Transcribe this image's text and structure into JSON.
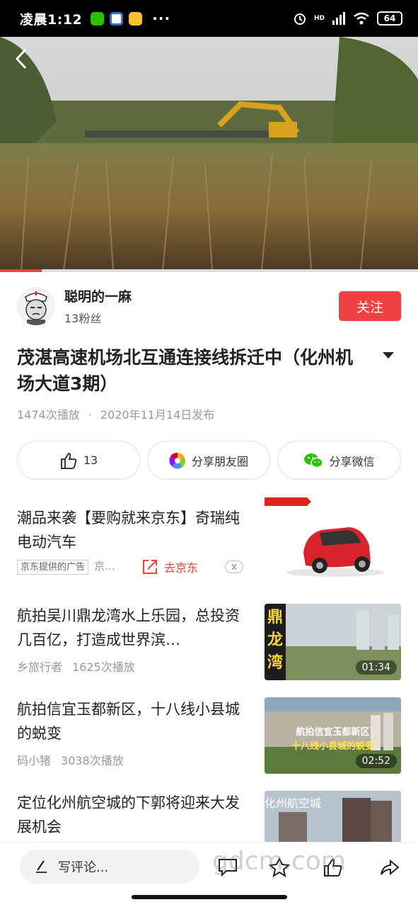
{
  "status_bar": {
    "time": "凌晨1:12",
    "more": "···",
    "network": "HD",
    "battery": "64",
    "icons": [
      "wechat-icon",
      "messenger-app-icon",
      "notes-app-icon",
      "alarm-icon",
      "signal-icon",
      "wifi-icon",
      "battery-icon"
    ]
  },
  "video": {
    "progress": 0.1,
    "icons": [
      "back-icon"
    ]
  },
  "author": {
    "name": "聪明的一麻",
    "fans": "13粉丝",
    "follow_label": "关注"
  },
  "article": {
    "title": "茂湛高速机场北互通连接线拆迁中（化州机场大道3期）",
    "views": "1474次播放",
    "separator": "·",
    "date": "2020年11月14日发布"
  },
  "actions": {
    "like_count": "13",
    "moments_label": "分享朋友圈",
    "wechat_label": "分享微信"
  },
  "ad": {
    "title": "潮品来袭【要购就来京东】奇瑞纯电动汽车",
    "tag": "京东提供的广告",
    "source": "京…",
    "cta": "去京东"
  },
  "related": [
    {
      "title": "航拍吴川鼎龙湾水上乐园，总投资几百亿，打造成世界滨…",
      "author": "乡旅行者",
      "plays": "1625次播放",
      "duration": "01:34",
      "thumb_text": "鼎龙湾"
    },
    {
      "title": "航拍信宜玉都新区，十八线小县城的蜕变",
      "author": "码小猪",
      "plays": "3038次播放",
      "duration": "02:52",
      "thumb_text_1": "航拍信宜玉都新区",
      "thumb_text_2": "十八线小县城的蜕变"
    },
    {
      "title": "定位化州航空城的下郭将迎来大发展机会",
      "thumb_text": "化州航空城"
    }
  ],
  "bottom_bar": {
    "comment_placeholder": "写评论...",
    "watermark": "gdcm.com"
  },
  "colors": {
    "accent": "#f04142",
    "text": "#222222",
    "muted": "#999999"
  }
}
